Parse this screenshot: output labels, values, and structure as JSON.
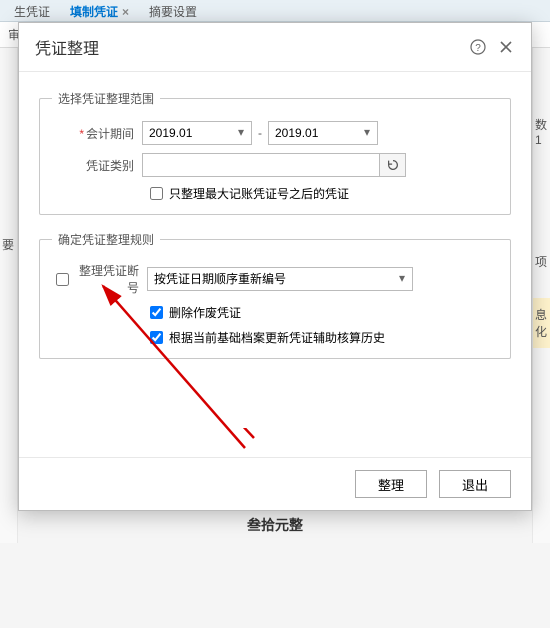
{
  "tabs": {
    "t1": "生凭证",
    "t2": "填制凭证",
    "t3": "摘要设置"
  },
  "bg": {
    "row1": "审核",
    "side_left_1": "要",
    "side_right_1": "数 1",
    "side_right_2": "项",
    "side_right_3": "息化",
    "bottom": "叁拾元整"
  },
  "dialog": {
    "title": "凭证整理",
    "group1": {
      "legend": "选择凭证整理范围",
      "period_label": "会计期间",
      "period_from": "2019.01",
      "period_to": "2019.01",
      "type_label": "凭证类别",
      "type_value": "",
      "only_after_max_label": "只整理最大记账凭证号之后的凭证"
    },
    "group2": {
      "legend": "确定凭证整理规则",
      "break_label": "整理凭证断号",
      "rule_option": "按凭证日期顺序重新编号",
      "del_void_label": "删除作废凭证",
      "update_aux_label": "根据当前基础档案更新凭证辅助核算历史"
    },
    "footer": {
      "ok": "整理",
      "cancel": "退出"
    }
  }
}
